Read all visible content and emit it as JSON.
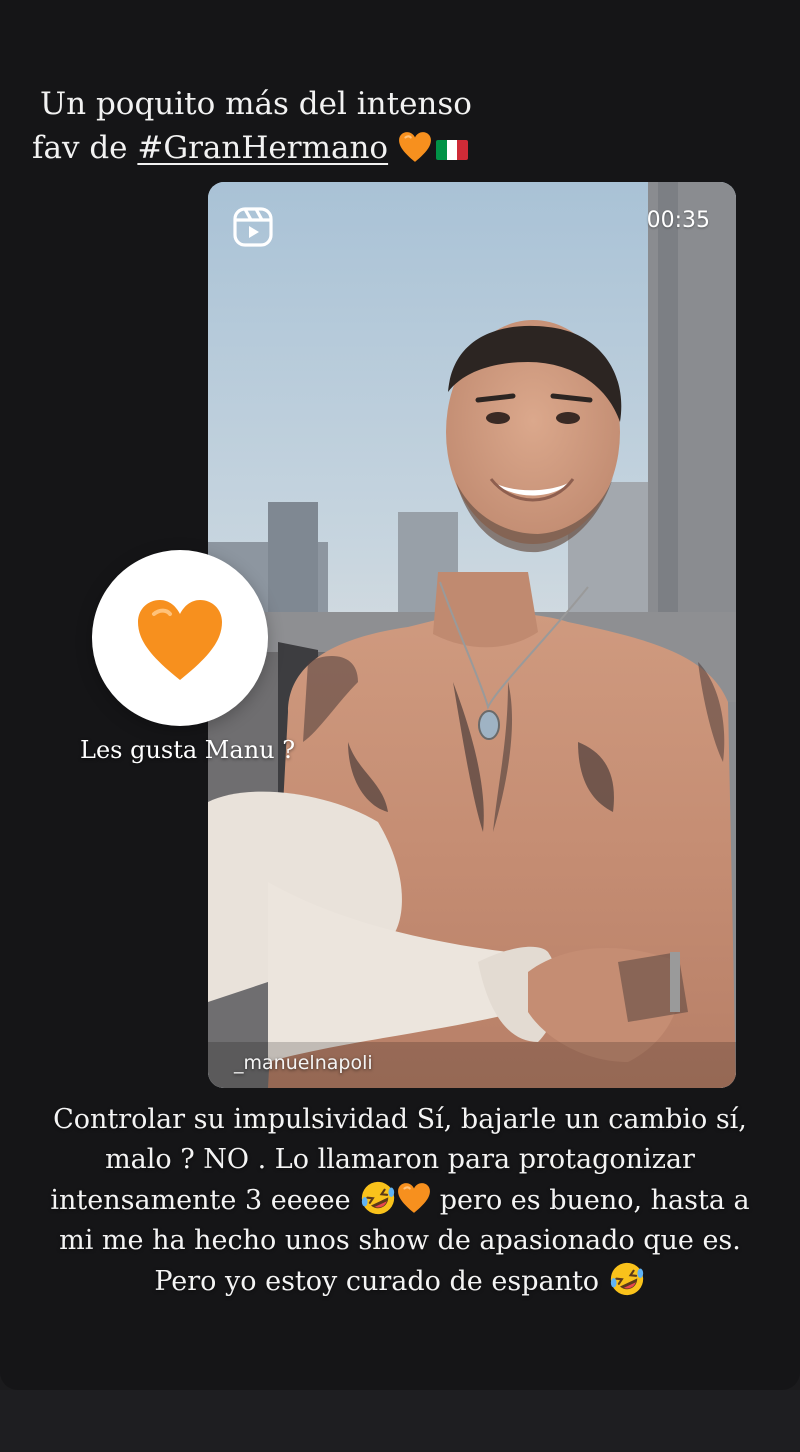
{
  "story": {
    "caption_top": {
      "line1": "Un poquito más del intenso",
      "line2_prefix": "fav de ",
      "hashtag": "#GranHermano",
      "heart_icon": "orange-heart-icon",
      "flag_icon": "italy-flag-icon"
    },
    "reel": {
      "icon": "reels-icon",
      "duration": "00:35",
      "username": "_manuelnapoli"
    },
    "poll_sticker": {
      "emoji": "orange-heart-icon",
      "question": "Les gusta Manu ?"
    },
    "caption_bottom": {
      "line1": "Controlar su impulsividad Sí, bajarle un cambio sí,",
      "line2": "malo ? NO . Lo llamaron para protagonizar",
      "line3_a": "intensamente 3  eeeee ",
      "line3_b": " pero es bueno, hasta a",
      "line4": "mi me ha hecho unos show de apasionado que es.",
      "line5": "Pero yo estoy curado de espanto ",
      "emoji_laugh": "rolling-on-floor-laughing-icon",
      "emoji_heart": "orange-heart-icon"
    }
  },
  "colors": {
    "background": "#151517",
    "heart": "#f7901e",
    "flag_green": "#009246",
    "flag_white": "#ffffff",
    "flag_red": "#ce2b37"
  }
}
